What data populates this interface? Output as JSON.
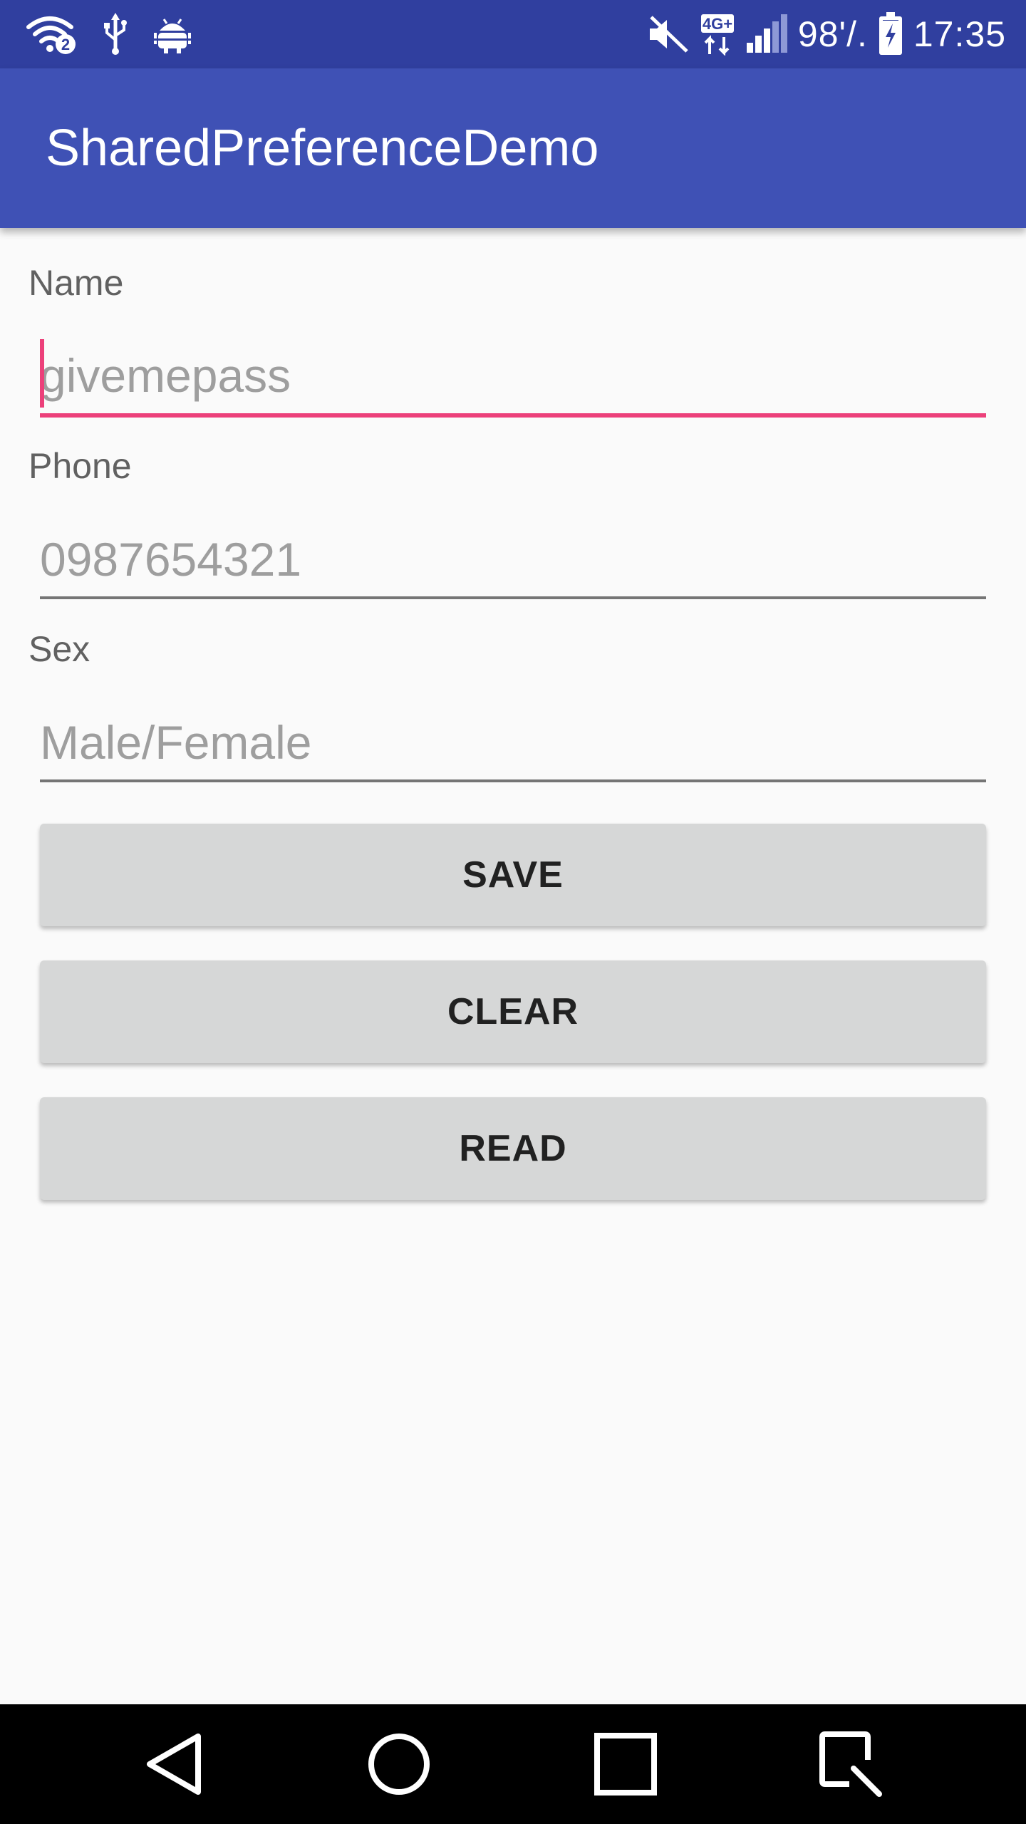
{
  "status_bar": {
    "wifi_icon": "wifi-icon",
    "wifi_badge": "2",
    "usb_icon": "usb-icon",
    "debug_icon": "android-debug-icon",
    "mute_icon": "mute-icon",
    "network_icon": "network-4g-icon",
    "network_label": "4G+",
    "signal_icon": "signal-icon",
    "battery_percent": "98'/.",
    "battery_icon": "battery-charging-icon",
    "time": "17:35",
    "background_color": "#303f9f"
  },
  "app_bar": {
    "title": "SharedPreferenceDemo",
    "background_color": "#3f51b5"
  },
  "form": {
    "name": {
      "label": "Name",
      "placeholder": "givemepass",
      "value": "",
      "focused": true
    },
    "phone": {
      "label": "Phone",
      "placeholder": "0987654321",
      "value": ""
    },
    "sex": {
      "label": "Sex",
      "placeholder": "Male/Female",
      "value": ""
    },
    "accent_color": "#ec407a"
  },
  "buttons": {
    "save": "SAVE",
    "clear": "CLEAR",
    "read": "READ"
  },
  "nav_bar": {
    "back_icon": "back-icon",
    "home_icon": "home-icon",
    "recents_icon": "recents-icon",
    "extra_icon": "quick-action-icon"
  }
}
